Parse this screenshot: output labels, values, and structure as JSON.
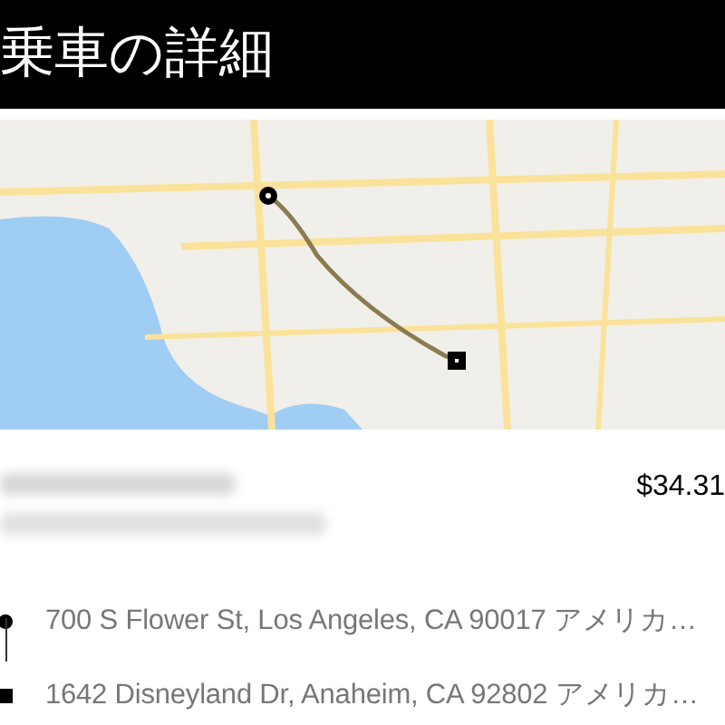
{
  "header": {
    "title": "乗車の詳細"
  },
  "trip": {
    "fare": "$34.31"
  },
  "route": [
    {
      "kind": "pickup",
      "address": "700 S Flower St, Los Angeles, CA 90017 アメリカ…"
    },
    {
      "kind": "dropoff",
      "address": "1642 Disneyland Dr, Anaheim, CA 92802 アメリカ…"
    }
  ]
}
